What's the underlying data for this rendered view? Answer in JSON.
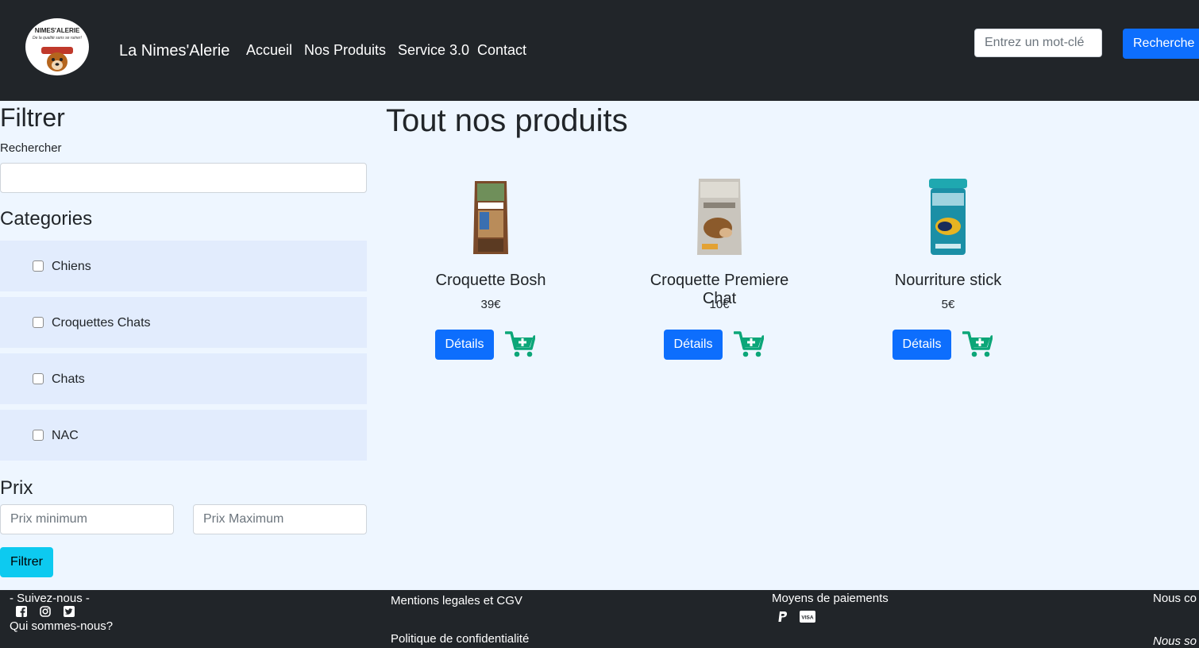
{
  "navbar": {
    "logo": {
      "line1": "NIMES'ALERIE",
      "line2": "De la qualité sans se ruiner!"
    },
    "brand": "La Nimes'Alerie",
    "links": [
      "Accueil",
      "Nos Produits",
      "Service 3.0",
      "Contact"
    ],
    "search": {
      "placeholder": "Entrez un mot-clé",
      "button": "Recherche"
    }
  },
  "sidebar": {
    "title": "Filtrer",
    "search_label": "Rechercher",
    "categories_title": "Categories",
    "categories": [
      "Chiens",
      "Croquettes Chats",
      "Chats",
      "NAC"
    ],
    "price_title": "Prix",
    "price_min_placeholder": "Prix minimum",
    "price_max_placeholder": "Prix Maximum",
    "filter_button": "Filtrer"
  },
  "main": {
    "title": "Tout nos produits",
    "products": [
      {
        "name": "Croquette Bosh",
        "price": "39€",
        "details": "Détails",
        "image": "dog-food-bag-icon"
      },
      {
        "name": "Croquette Premiere Chat",
        "price": "10€",
        "details": "Détails",
        "image": "cat-food-bag-icon"
      },
      {
        "name": "Nourriture stick",
        "price": "5€",
        "details": "Détails",
        "image": "fish-food-tub-icon"
      }
    ]
  },
  "footer": {
    "follow": "- Suivez-nous -",
    "about": "Qui sommes-nous?",
    "legal": "Mentions legales et CGV",
    "privacy": "Politique de confidentialité",
    "payments": "Moyens de paiements",
    "visa_label": "VISA",
    "contact_partial": "Nous co",
    "tagline_partial": "Nous so"
  },
  "colors": {
    "navbar": "#212529",
    "primary": "#0d6efd",
    "info": "#0dcaf0",
    "cart": "#0ca678",
    "category_bg": "#e2ecfd",
    "page_bg": "#eef6ff"
  }
}
